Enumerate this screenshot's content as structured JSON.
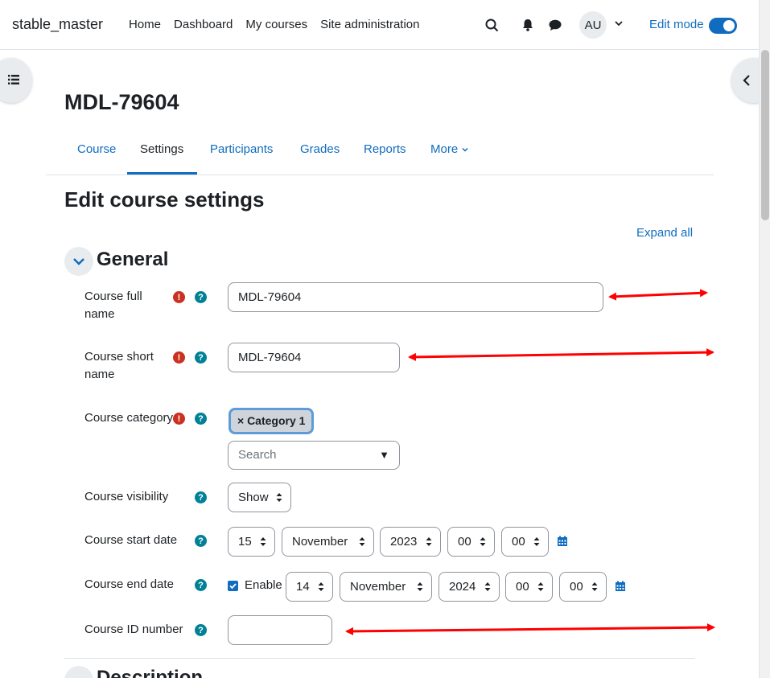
{
  "navbar": {
    "brand": "stable_master",
    "links": [
      "Home",
      "Dashboard",
      "My courses",
      "Site administration"
    ],
    "avatar": "AU",
    "edit_mode_label": "Edit mode",
    "edit_mode_on": true
  },
  "course_title": "MDL-79604",
  "tabs": [
    "Course",
    "Settings",
    "Participants",
    "Grades",
    "Reports",
    "More"
  ],
  "active_tab": "Settings",
  "form_title": "Edit course settings",
  "expand_all": "Expand all",
  "sections": {
    "general": "General",
    "description": "Description"
  },
  "fields": {
    "full_name": {
      "label": "Course full name",
      "value": "MDL-79604"
    },
    "short_name": {
      "label": "Course short name",
      "value": "MDL-79604"
    },
    "category": {
      "label": "Course category",
      "chip": "× Category 1",
      "search_placeholder": "Search"
    },
    "visibility": {
      "label": "Course visibility",
      "value": "Show"
    },
    "start_date": {
      "label": "Course start date",
      "day": "15",
      "month": "November",
      "year": "2023",
      "hour": "00",
      "minute": "00"
    },
    "end_date": {
      "label": "Course end date",
      "enable_label": "Enable",
      "enabled": true,
      "day": "14",
      "month": "November",
      "year": "2024",
      "hour": "00",
      "minute": "00"
    },
    "id_number": {
      "label": "Course ID number",
      "value": ""
    }
  },
  "colors": {
    "link": "#0f6cbf",
    "required": "#ca3120",
    "help": "#008196",
    "annotation_arrow": "#ff0000"
  }
}
